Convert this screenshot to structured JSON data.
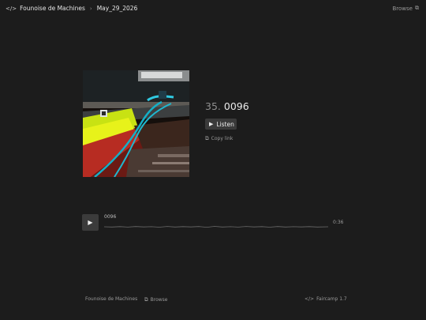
{
  "header": {
    "logo_icon": "code-slash-icon",
    "artist": "Founoise de Machines",
    "separator": "›",
    "release": "May_29_2026",
    "browse_label": "Browse"
  },
  "release": {
    "track_number": "35.",
    "title": "0096",
    "listen_label": "Listen",
    "copy_link_label": "Copy link"
  },
  "player": {
    "track_name": "0096",
    "duration": "0:36"
  },
  "footer": {
    "artist": "Founoise de Machines",
    "browse_label": "Browse",
    "faircamp_label": "Faircamp 1.7"
  },
  "colors": {
    "background": "#1c1c1c",
    "button": "#3a3a3a",
    "text": "#d8d8d8",
    "muted": "#9a9a9a"
  }
}
